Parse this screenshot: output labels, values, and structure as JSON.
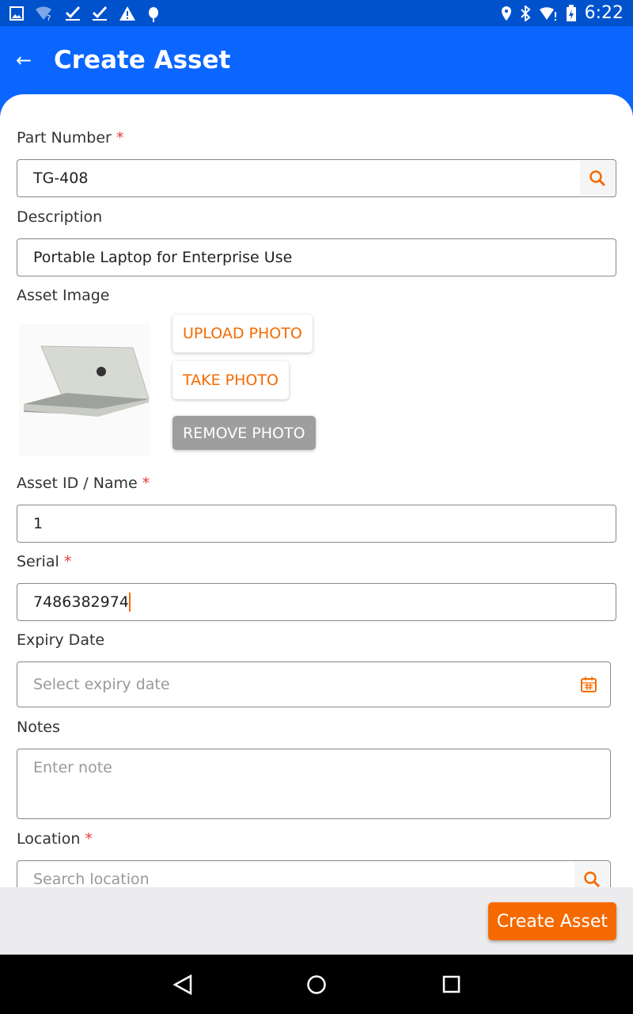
{
  "status_bar": {
    "time": "6:22",
    "left_icons": [
      "image-icon",
      "wifi-question-icon",
      "check-icon",
      "check-icon",
      "warning-icon",
      "android-icon"
    ],
    "right_icons": [
      "location-icon",
      "bluetooth-icon",
      "wifi-alert-icon",
      "battery-charging-icon"
    ]
  },
  "header": {
    "title": "Create Asset",
    "back_icon": "arrow-left-icon"
  },
  "colors": {
    "primary": "#0a66ff",
    "status_bar": "#0052cc",
    "accent": "#f56a00",
    "required": "#e53935"
  },
  "form": {
    "part_number": {
      "label": "Part Number",
      "required": "*",
      "value": "TG-408"
    },
    "description": {
      "label": "Description",
      "value": "Portable Laptop for Enterprise Use"
    },
    "asset_image": {
      "label": "Asset Image",
      "upload": "UPLOAD PHOTO",
      "take": "TAKE PHOTO",
      "remove": "REMOVE PHOTO"
    },
    "asset_id": {
      "label": "Asset ID / Name",
      "required": "*",
      "value": "1"
    },
    "serial": {
      "label": "Serial",
      "required": "*",
      "value": "7486382974"
    },
    "expiry": {
      "label": "Expiry Date",
      "placeholder": "Select expiry date"
    },
    "notes": {
      "label": "Notes",
      "placeholder": "Enter note"
    },
    "location": {
      "label": "Location",
      "required": "*",
      "placeholder": "Search location"
    }
  },
  "footer": {
    "create_label": "Create Asset"
  }
}
